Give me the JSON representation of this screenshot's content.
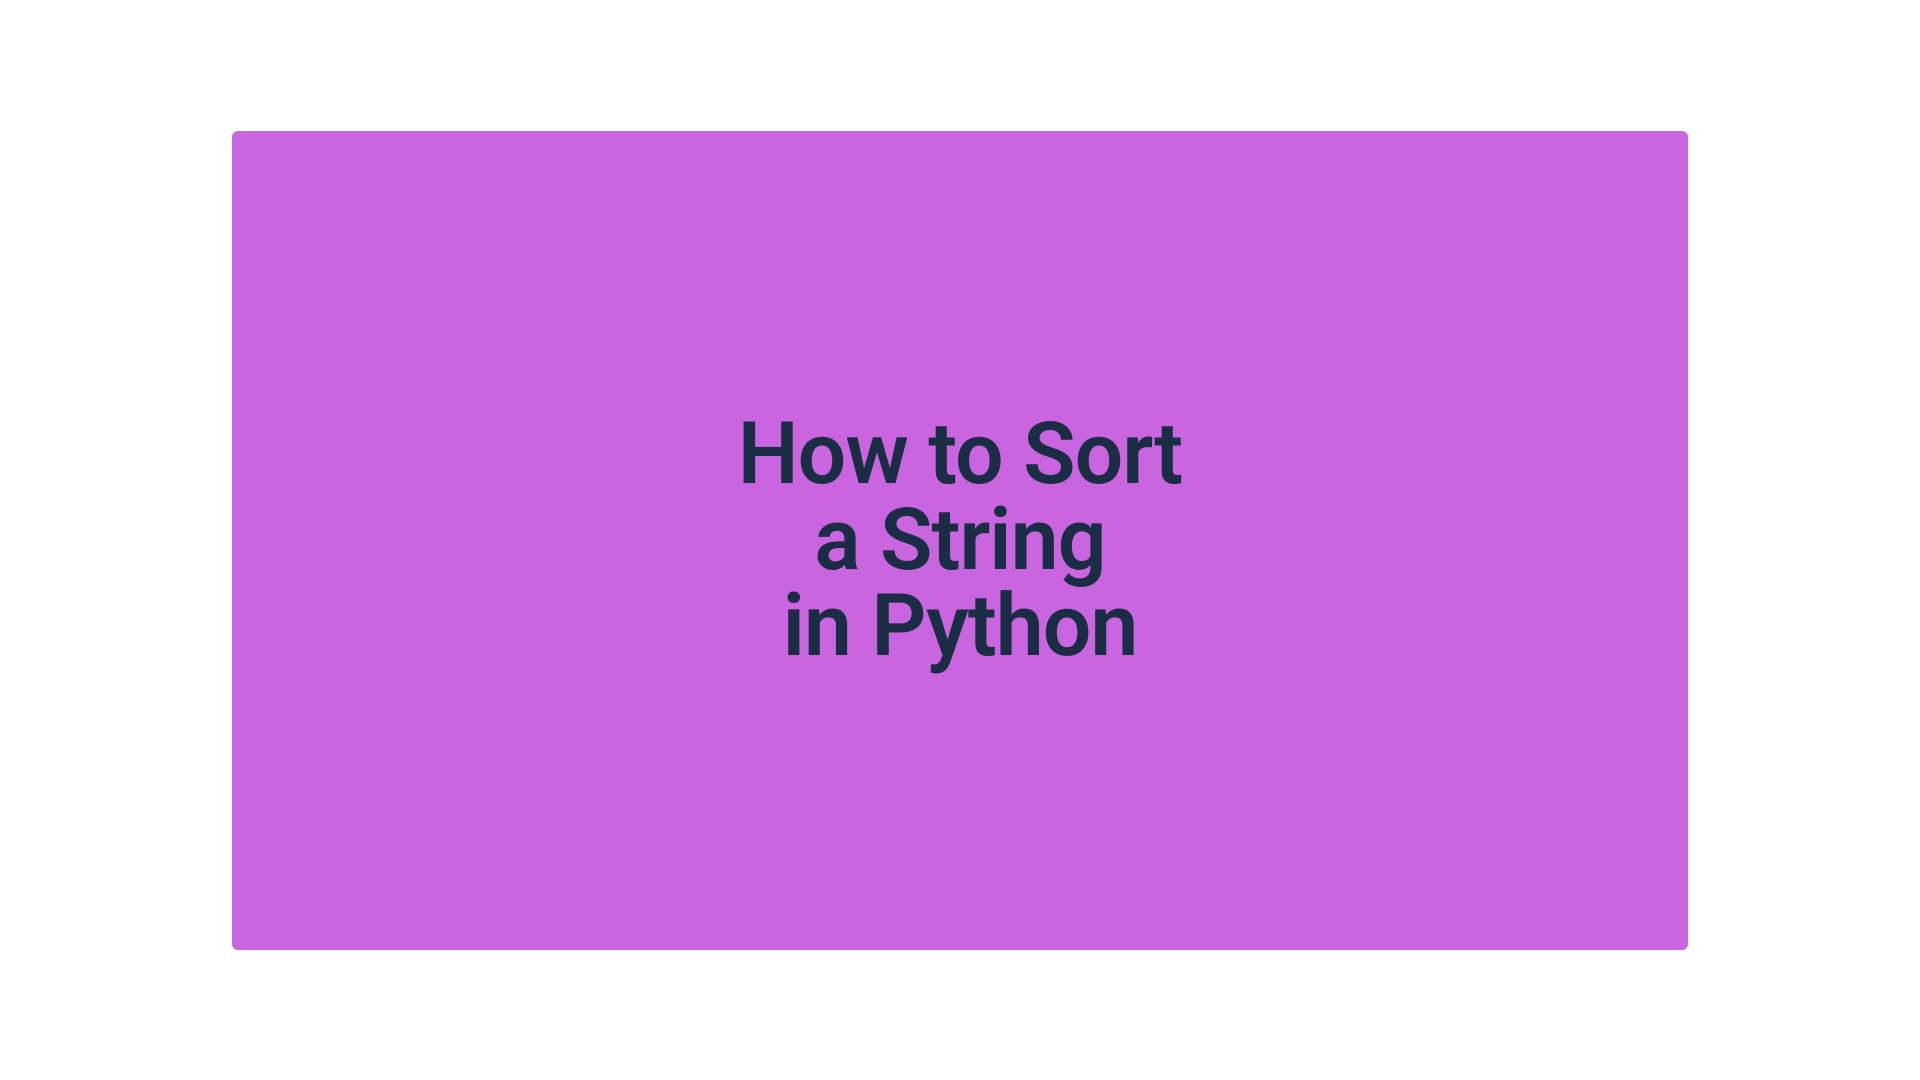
{
  "title": {
    "line1": "How to Sort",
    "line2": "a String",
    "line3": "in Python"
  },
  "colors": {
    "background": "#c966df",
    "text": "#1b2c45"
  }
}
